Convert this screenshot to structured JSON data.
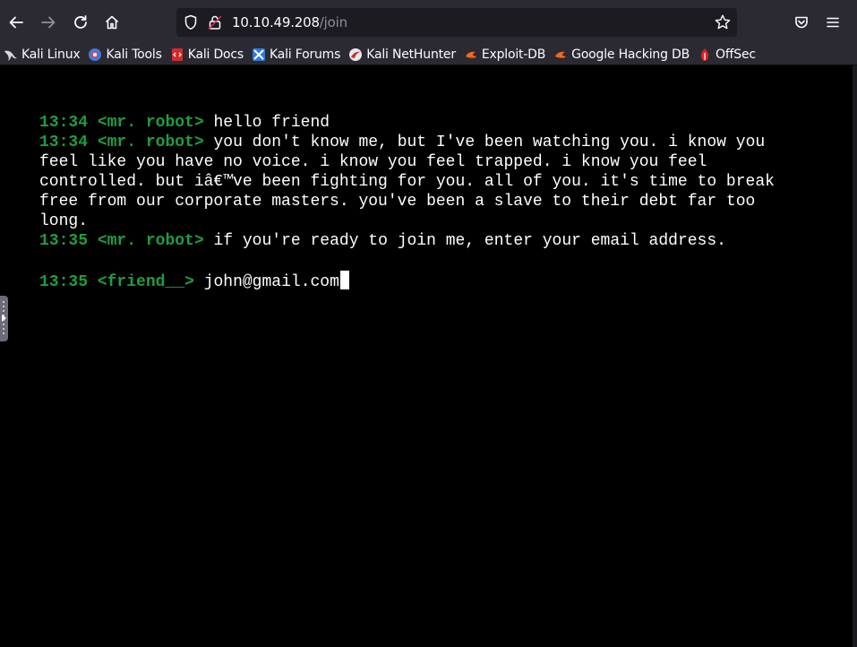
{
  "browser": {
    "url_host": "10.10.49.208",
    "url_path": "/join"
  },
  "bookmarks": [
    {
      "label": "Kali Linux",
      "icon": "kali-dragon-icon"
    },
    {
      "label": "Kali Tools",
      "icon": "kali-tools-icon"
    },
    {
      "label": "Kali Docs",
      "icon": "kali-docs-icon"
    },
    {
      "label": "Kali Forums",
      "icon": "kali-forums-icon"
    },
    {
      "label": "Kali NetHunter",
      "icon": "kali-nethunter-icon"
    },
    {
      "label": "Exploit-DB",
      "icon": "exploit-db-icon"
    },
    {
      "label": "Google Hacking DB",
      "icon": "ghdb-icon"
    },
    {
      "label": "OffSec",
      "icon": "offsec-icon"
    }
  ],
  "chat": {
    "messages": [
      {
        "time": "13:34",
        "user": "<mr. robot>",
        "text": "hello friend"
      },
      {
        "time": "13:34",
        "user": "<mr. robot>",
        "text": "you don't know me, but I've been watching you. i know you feel like you have no voice. i know you feel trapped. i know you feel controlled. but iâ€™ve been fighting for you. all of you. it's time to break free from our corporate masters. you've been a slave to their debt far too long."
      },
      {
        "time": "13:35",
        "user": "<mr. robot>",
        "text": "if you're ready to join me, enter your email address."
      }
    ],
    "input_line": {
      "time": "13:35",
      "user": "<friend__>",
      "text": "john@gmail.com"
    }
  },
  "colors": {
    "terminal_bg": "#000000",
    "meta_green": "#1e9e40",
    "text": "#ffffff",
    "toolbar_bg": "#2b2a33"
  }
}
